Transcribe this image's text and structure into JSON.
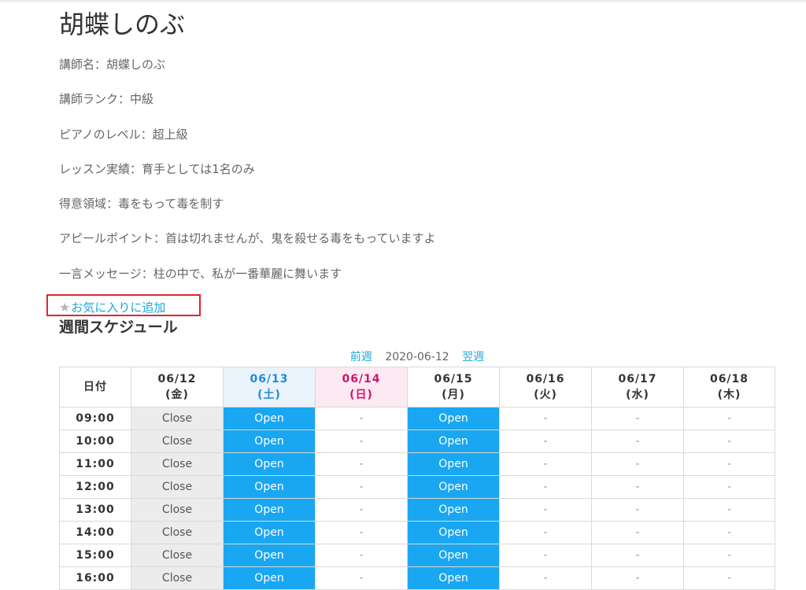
{
  "teacher": {
    "name": "胡蝶しのぶ",
    "info": [
      "講師名：胡蝶しのぶ",
      "講師ランク：中級",
      "ピアノのレベル：超上級",
      "レッスン実績：育手としては1名のみ",
      "得意領域：毒をもって毒を制す",
      "アピールポイント：首は切れませんが、鬼を殺せる毒をもっていますよ",
      "一言メッセージ：柱の中で、私が一番華麗に舞います"
    ]
  },
  "favorite": {
    "icon": "star-icon",
    "label": "お気に入りに追加",
    "highlight_color": "#e0262c"
  },
  "schedule": {
    "heading": "週間スケジュール",
    "nav": {
      "prev_label": "前週",
      "current_date": "2020-06-12",
      "next_label": "翌週"
    },
    "corner_label": "日付",
    "days": [
      {
        "date": "06/12",
        "weekday": "(金)"
      },
      {
        "date": "06/13",
        "weekday": "(土)"
      },
      {
        "date": "06/14",
        "weekday": "(日)"
      },
      {
        "date": "06/15",
        "weekday": "(月)"
      },
      {
        "date": "06/16",
        "weekday": "(火)"
      },
      {
        "date": "06/17",
        "weekday": "(水)"
      },
      {
        "date": "06/18",
        "weekday": "(木)"
      }
    ],
    "rows": [
      {
        "time": "09:00",
        "cells": [
          "Close",
          "Open",
          "-",
          "Open",
          "-",
          "-",
          "-"
        ]
      },
      {
        "time": "10:00",
        "cells": [
          "Close",
          "Open",
          "-",
          "Open",
          "-",
          "-",
          "-"
        ]
      },
      {
        "time": "11:00",
        "cells": [
          "Close",
          "Open",
          "-",
          "Open",
          "-",
          "-",
          "-"
        ]
      },
      {
        "time": "12:00",
        "cells": [
          "Close",
          "Open",
          "-",
          "Open",
          "-",
          "-",
          "-"
        ]
      },
      {
        "time": "13:00",
        "cells": [
          "Close",
          "Open",
          "-",
          "Open",
          "-",
          "-",
          "-"
        ]
      },
      {
        "time": "14:00",
        "cells": [
          "Close",
          "Open",
          "-",
          "Open",
          "-",
          "-",
          "-"
        ]
      },
      {
        "time": "15:00",
        "cells": [
          "Close",
          "Open",
          "-",
          "Open",
          "-",
          "-",
          "-"
        ]
      },
      {
        "time": "16:00",
        "cells": [
          "Close",
          "Open",
          "-",
          "Open",
          "-",
          "-",
          "-"
        ]
      }
    ],
    "colors": {
      "open": "#1aa7f2",
      "close": "#ececec",
      "saturday": "#1e8bd6",
      "sunday": "#d3136d",
      "link": "#1ba7d8"
    }
  }
}
